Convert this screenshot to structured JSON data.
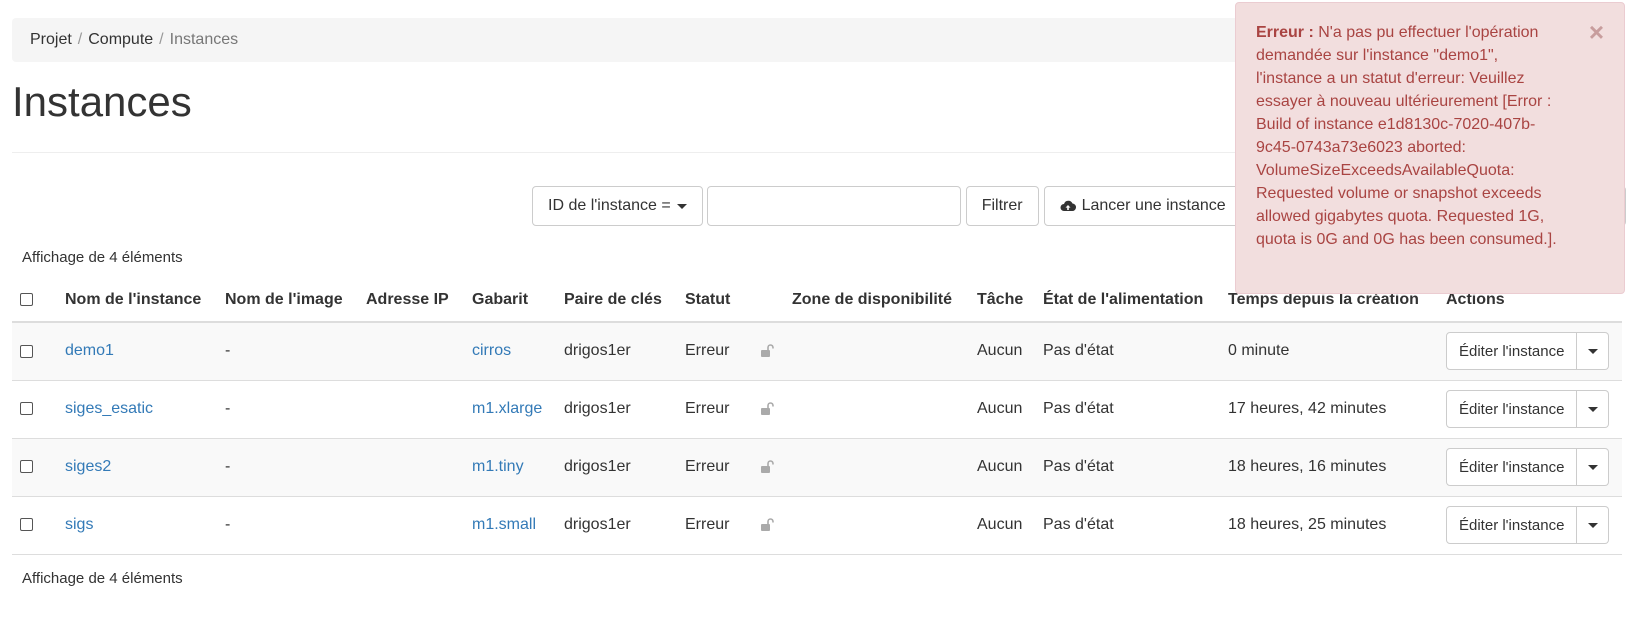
{
  "breadcrumb": [
    "Projet",
    "Compute",
    "Instances"
  ],
  "page_title": "Instances",
  "toolbar": {
    "filter_select": "ID de l'instance =",
    "filter_value": "",
    "filter_button": "Filtrer",
    "launch_button": "Lancer une instance"
  },
  "count_text": "Affichage de 4 éléments",
  "table": {
    "headers": [
      "Nom de l'instance",
      "Nom de l'image",
      "Adresse IP",
      "Gabarit",
      "Paire de clés",
      "Statut",
      "Zone de disponibilité",
      "Tâche",
      "État de l'alimentation",
      "Temps depuis la création",
      "Actions"
    ],
    "rows": [
      {
        "name": "demo1",
        "image": "-",
        "ip": "",
        "flavor": "cirros",
        "keypair": "drigos1er",
        "status": "Erreur",
        "zone": "",
        "task": "Aucun",
        "power": "Pas d'état",
        "age": "0 minute",
        "action": "Éditer l'instance"
      },
      {
        "name": "siges_esatic",
        "image": "-",
        "ip": "",
        "flavor": "m1.xlarge",
        "keypair": "drigos1er",
        "status": "Erreur",
        "zone": "",
        "task": "Aucun",
        "power": "Pas d'état",
        "age": "17 heures, 42 minutes",
        "action": "Éditer l'instance"
      },
      {
        "name": "siges2",
        "image": "-",
        "ip": "",
        "flavor": "m1.tiny",
        "keypair": "drigos1er",
        "status": "Erreur",
        "zone": "",
        "task": "Aucun",
        "power": "Pas d'état",
        "age": "18 heures, 16 minutes",
        "action": "Éditer l'instance"
      },
      {
        "name": "sigs",
        "image": "-",
        "ip": "",
        "flavor": "m1.small",
        "keypair": "drigos1er",
        "status": "Erreur",
        "zone": "",
        "task": "Aucun",
        "power": "Pas d'état",
        "age": "18 heures, 25 minutes",
        "action": "Éditer l'instance"
      }
    ]
  },
  "alert": {
    "label": "Erreur :",
    "message": "N'a pas pu effectuer l'opération demandée sur l'instance \"demo1\", l'instance a un statut d'erreur: Veuillez essayer à nouveau ultérieurement [Error : Build of instance e1d8130c-7020-407b-9c45-0743a73e6023 aborted: VolumeSizeExceedsAvailableQuota: Requested volume or snapshot exceeds allowed gigabytes quota. Requested 1G, quota is 0G and 0G has been consumed.].",
    "close_symbol": "×"
  },
  "colors": {
    "link": "#337ab7",
    "alert_bg": "#f2dede",
    "alert_text": "#a94442"
  },
  "icons": {
    "launch": "cloud-upload-icon",
    "status": "lock-open-icon",
    "close": "close-icon"
  }
}
